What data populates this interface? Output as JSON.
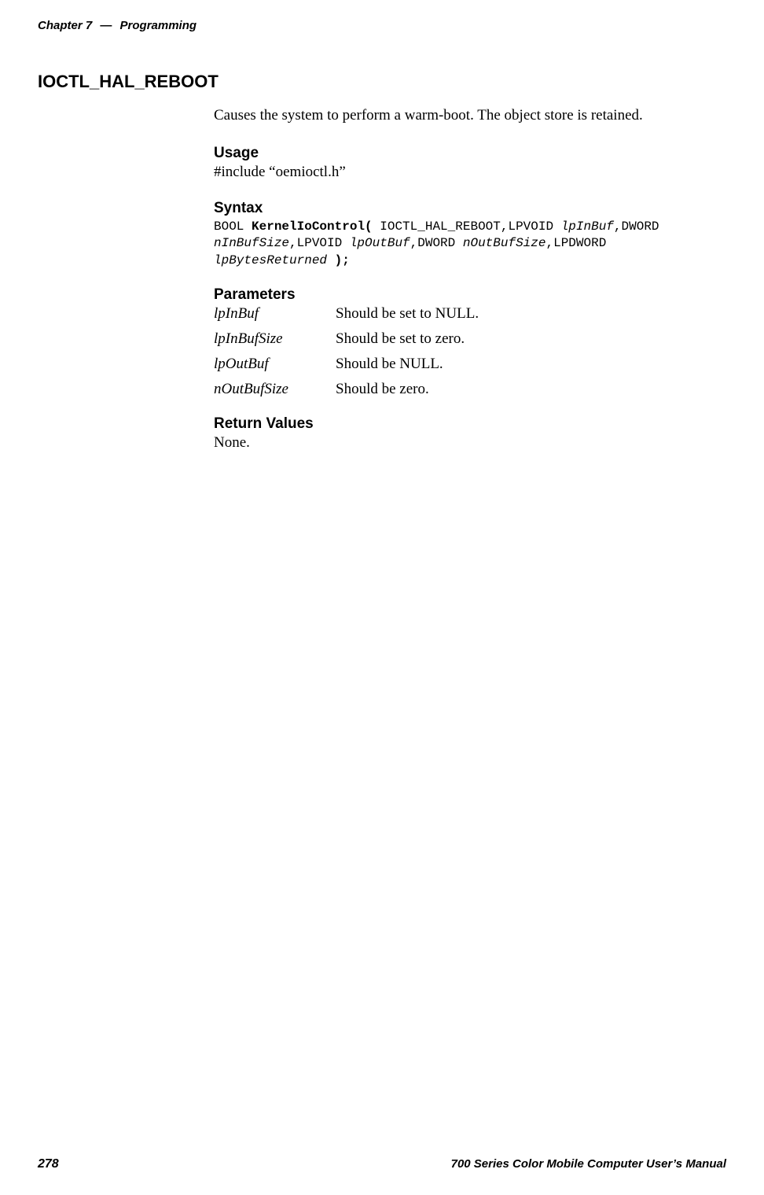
{
  "header": {
    "chapter": "Chapter 7",
    "separator": "—",
    "title": "Programming"
  },
  "section": {
    "title": "IOCTL_HAL_REBOOT"
  },
  "description": "Causes the system to perform a warm-boot. The object store is retained.",
  "usage": {
    "title": "Usage",
    "text": "#include “oemioctl.h”"
  },
  "syntax": {
    "title": "Syntax",
    "line1_pre": "BOOL ",
    "line1_bold": "KernelIoControl(",
    "line1_mid": " IOCTL_HAL_REBOOT,LPVOID ",
    "line1_italic": "lpInBuf",
    "line1_post": ",DWORD",
    "line2_italic1": "nInBufSize",
    "line2_mid1": ",LPVOID ",
    "line2_italic2": "lpOutBuf",
    "line2_mid2": ",DWORD ",
    "line2_italic3": "nOutBufSize",
    "line2_post": ",LPDWORD",
    "line3_italic": "lpBytesReturned",
    "line3_bold": " );"
  },
  "parameters": {
    "title": "Parameters",
    "items": [
      {
        "name": "lpInBuf",
        "desc": "Should be set to NULL."
      },
      {
        "name": "lpInBufSize",
        "desc": "Should be set to zero."
      },
      {
        "name": "lpOutBuf",
        "desc": "Should be NULL."
      },
      {
        "name": "nOutBufSize",
        "desc": "Should be zero."
      }
    ]
  },
  "return_values": {
    "title": "Return Values",
    "text": "None."
  },
  "footer": {
    "page_number": "278",
    "title": "700 Series Color Mobile Computer User’s Manual"
  }
}
